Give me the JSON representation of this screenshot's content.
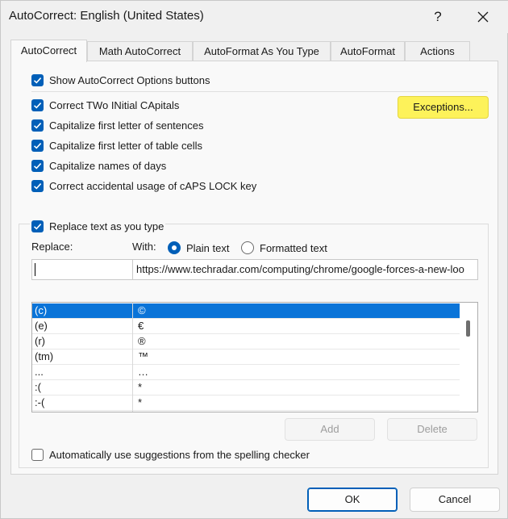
{
  "window": {
    "title": "AutoCorrect: English (United States)",
    "help_glyph": "?",
    "close_icon": "close-icon"
  },
  "tabs": [
    {
      "label": "AutoCorrect",
      "active": true
    },
    {
      "label": "Math AutoCorrect",
      "active": false
    },
    {
      "label": "AutoFormat As You Type",
      "active": false
    },
    {
      "label": "AutoFormat",
      "active": false
    },
    {
      "label": "Actions",
      "active": false
    }
  ],
  "options": {
    "show_buttons": {
      "label": "Show AutoCorrect Options buttons",
      "checked": true
    },
    "two_initial_caps": {
      "label": "Correct TWo INitial CApitals",
      "checked": true
    },
    "first_letter_sentences": {
      "label": "Capitalize first letter of sentences",
      "checked": true
    },
    "first_letter_table_cells": {
      "label": "Capitalize first letter of table cells",
      "checked": true
    },
    "names_of_days": {
      "label": "Capitalize names of days",
      "checked": true
    },
    "caps_lock": {
      "label": "Correct accidental usage of cAPS LOCK key",
      "checked": true
    },
    "exceptions_button": "Exceptions..."
  },
  "replace_section": {
    "replace_text_checkbox": {
      "label": "Replace text as you type",
      "checked": true
    },
    "replace_label": "Replace:",
    "with_label": "With:",
    "plain_text": {
      "label": "Plain text",
      "selected": true
    },
    "formatted_text": {
      "label": "Formatted text",
      "selected": false
    },
    "replace_value": "",
    "with_value": "https://www.techradar.com/computing/chrome/google-forces-a-new-loo",
    "entries": [
      {
        "replace": "(c)",
        "with": "©",
        "selected": true
      },
      {
        "replace": "(e)",
        "with": "€",
        "selected": false
      },
      {
        "replace": "(r)",
        "with": "®",
        "selected": false
      },
      {
        "replace": "(tm)",
        "with": "™",
        "selected": false
      },
      {
        "replace": "...",
        "with": "…",
        "selected": false
      },
      {
        "replace": ":(",
        "with": "*",
        "selected": false
      },
      {
        "replace": ":-(",
        "with": "*",
        "selected": false
      }
    ],
    "add_button": "Add",
    "delete_button": "Delete"
  },
  "spelling_suggestions": {
    "label": "Automatically use suggestions from the spelling checker",
    "checked": false
  },
  "footer": {
    "ok_button": "OK",
    "cancel_button": "Cancel"
  },
  "colors": {
    "accent": "#005fb8",
    "selection": "#0a74d8",
    "highlight": "#fdf25a"
  }
}
